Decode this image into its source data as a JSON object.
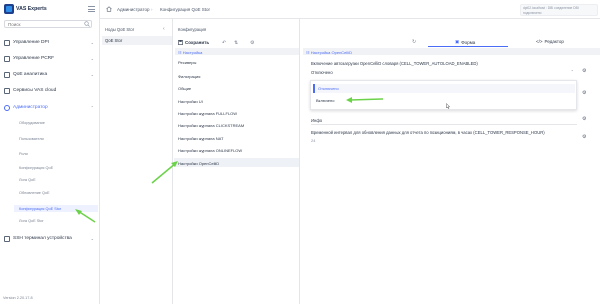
{
  "app": {
    "logo_text": "VAS Experts",
    "version": "Version 2.20.17.8"
  },
  "search": {
    "placeholder": "Поиск"
  },
  "nav": [
    {
      "label": "Управление DPI",
      "icon": "dpi-icon"
    },
    {
      "label": "Управление PCRF",
      "icon": "pcrf-icon"
    },
    {
      "label": "QoE аналитика",
      "icon": "analytics-icon"
    },
    {
      "label": "Сервисы VAS cloud",
      "icon": "cloud-icon"
    },
    {
      "label": "Администратор",
      "icon": "admin-icon"
    }
  ],
  "admin_sub": [
    "Оборудование",
    "Пользователи",
    "Роли",
    "Конфигурация QoE",
    "Лога QoE",
    "Обновление QoE",
    "Конфигурация QoE Stor",
    "Лога QoE Stor"
  ],
  "ssh": {
    "label": "SSH терминал устройства"
  },
  "topbar": {
    "crumbs": [
      "Администратор",
      "Конфигурация QoE Stor"
    ],
    "notification": "dpi02.localhost : DBI соединение DBI подключено"
  },
  "col1": {
    "title": "Ноды QoE Stor",
    "row": "QoE Stor"
  },
  "col2": {
    "title": "Конфигурация",
    "save_label": "Сохранить",
    "head": "Настройка",
    "items": [
      "Ресиверы",
      "Фильтрация",
      "Общие",
      "Настройки UI",
      "Настройки журнала FULLFLOW",
      "Настройки журнала CLICKSTREAM",
      "Настройки журнала NAT",
      "Настройки журнала ONLINEFLOW",
      "Настройки OpenCelliD"
    ],
    "active_index": 8
  },
  "col3": {
    "head": "Настройка OpenCelliD",
    "tabs": {
      "form": "Форма",
      "editor": "Редактор"
    },
    "field1_label": "Включение автозагрузки OpenCelliD словаря (CELL_TOWER_AUTOLOAD_ENABLED)",
    "field1_value": "Отключено",
    "options": [
      "Отключено",
      "Включено"
    ],
    "field2_value": "Инфо",
    "field3_label": "Временной интервал для обновления данных для отчета по позициониям, в часах (CELL_TOWER_RESPONSE_HOUR)",
    "field3_value": "24"
  },
  "colors": {
    "accent": "#4a6cf7",
    "arrow": "#6cd24a"
  }
}
